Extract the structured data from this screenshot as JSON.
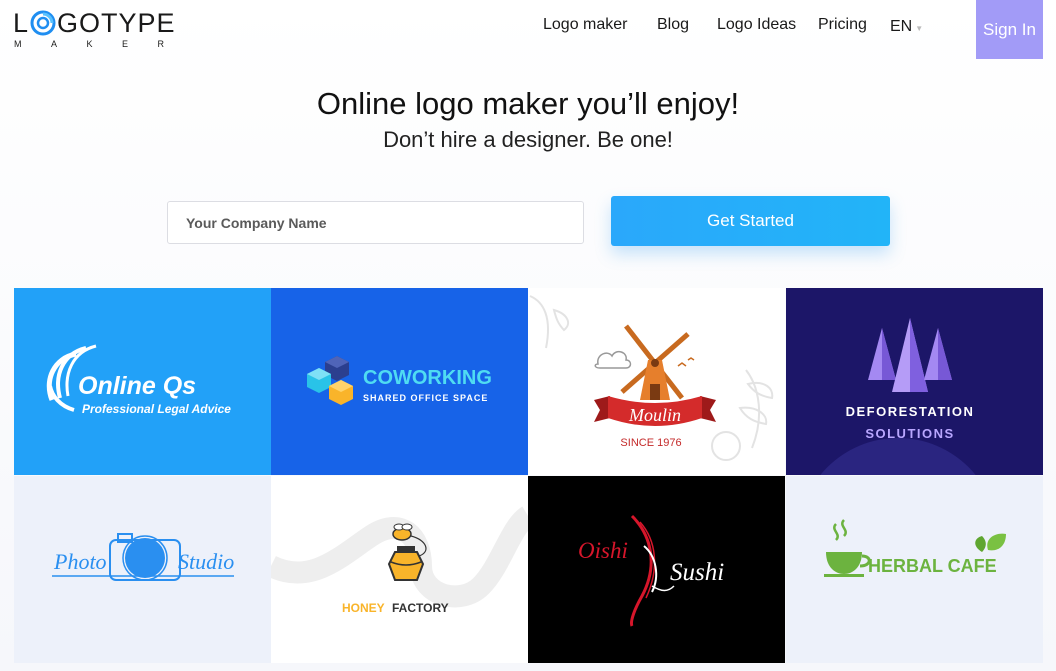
{
  "header": {
    "logo_brand": "LOGOTYPE",
    "logo_brand_first": "L",
    "logo_brand_rest": "GOTYPE",
    "logo_sub_letters": [
      "M",
      "A",
      "K",
      "E",
      "R"
    ],
    "nav": {
      "logo_maker": "Logo maker",
      "blog": "Blog",
      "logo_ideas": "Logo Ideas",
      "pricing": "Pricing",
      "language": "EN"
    },
    "sign_in": "Sign In"
  },
  "hero": {
    "title": "Online logo maker you’ll enjoy!",
    "subtitle": "Don’t hire a designer. Be one!",
    "input_placeholder": "Your Company Name",
    "cta": "Get Started"
  },
  "colors": {
    "accent_signin": "#a29bf7",
    "cta_blue": "#2aa8fb"
  },
  "examples": [
    {
      "name": "online-qs",
      "title": "Online Qs",
      "subtitle": "Professional Legal Advice",
      "background": "#22a1f8"
    },
    {
      "name": "coworking",
      "title": "COWORKING",
      "subtitle": "SHARED OFFICE SPACE",
      "background": "#1763e8"
    },
    {
      "name": "moulin",
      "title": "Moulin",
      "subtitle": "SINCE 1976",
      "background": "#ffffff"
    },
    {
      "name": "deforestation",
      "title": "DEFORESTATION",
      "subtitle": "SOLUTIONS",
      "background": "#1c1668"
    },
    {
      "name": "photo-studio",
      "title_left": "Photo",
      "title_right": "Studio",
      "background": "#edf1fa"
    },
    {
      "name": "honey-factory",
      "title_left": "HONEY",
      "title_right": "FACTORY",
      "background": "#ffffff"
    },
    {
      "name": "oishi-sushi",
      "title_left": "Oishi",
      "title_right": "Sushi",
      "background": "#000000"
    },
    {
      "name": "herbal-cafe",
      "title": "HERBAL CAFE",
      "background": "#edf1fa"
    }
  ]
}
